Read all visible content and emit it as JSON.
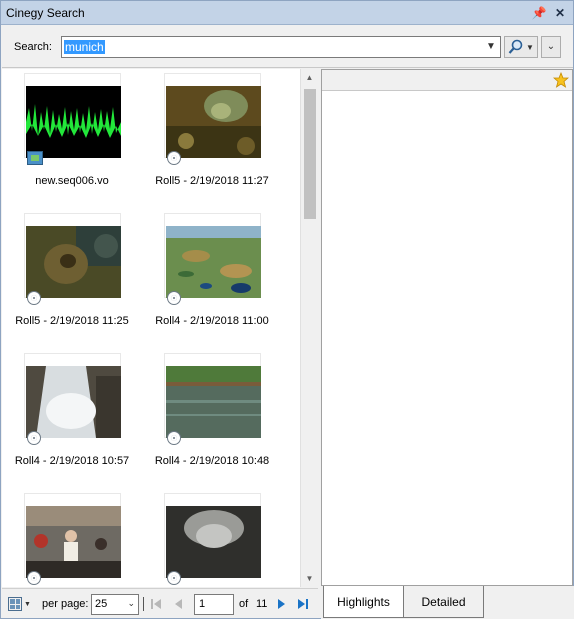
{
  "window": {
    "title": "Cinegy Search",
    "pin_icon": "pin-icon",
    "close_icon": "close-icon"
  },
  "search": {
    "label": "Search:",
    "value": "munich"
  },
  "results": [
    {
      "label": "new.seq006.vo",
      "type": "sequence"
    },
    {
      "label": "Roll5 - 2/19/2018 11:27",
      "type": "clip"
    },
    {
      "label": "Roll5 - 2/19/2018 11:25",
      "type": "clip"
    },
    {
      "label": "Roll4 - 2/19/2018 11:00",
      "type": "clip"
    },
    {
      "label": "Roll4 - 2/19/2018 10:57",
      "type": "clip"
    },
    {
      "label": "Roll4 - 2/19/2018 10:48",
      "type": "clip"
    },
    {
      "label": "",
      "type": "clip"
    },
    {
      "label": "",
      "type": "clip"
    }
  ],
  "pager": {
    "per_page_label": "per page:",
    "per_page_value": "25",
    "current_page": "1",
    "of_label": "of",
    "total_pages": "11"
  },
  "tabs": [
    {
      "label": "Highlights"
    },
    {
      "label": "Detailed"
    }
  ],
  "colors": {
    "titlebar": "#c3d3e7",
    "selection": "#3399ff",
    "nav_blue": "#1a73c6"
  }
}
